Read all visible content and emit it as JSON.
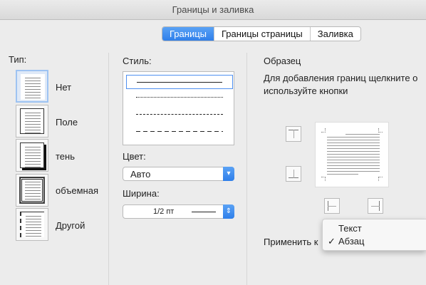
{
  "window": {
    "title": "Границы и заливка"
  },
  "tabs": [
    "Границы",
    "Границы страницы",
    "Заливка"
  ],
  "type_section": {
    "label": "Тип:",
    "options": [
      {
        "label": "Нет",
        "selected": true,
        "icon": "no-border-icon"
      },
      {
        "label": "Поле",
        "selected": false,
        "icon": "box-border-icon"
      },
      {
        "label": "тень",
        "selected": false,
        "icon": "shadow-border-icon"
      },
      {
        "label": "объемная",
        "selected": false,
        "icon": "3d-border-icon"
      },
      {
        "label": "Другой",
        "selected": false,
        "icon": "custom-border-icon"
      }
    ]
  },
  "style_section": {
    "label": "Стиль:",
    "styles": [
      "solid",
      "dotted",
      "dashed",
      "long-dashed"
    ],
    "selected_style": "solid",
    "color_label": "Цвет:",
    "color_value": "Авто",
    "width_label": "Ширина:",
    "width_value": "1/2 пт"
  },
  "preview_section": {
    "label": "Образец",
    "hint": "Для добавления границ щелкните о используйте кнопки",
    "apply_label": "Применить к"
  },
  "apply_menu": {
    "items": [
      "Текст",
      "Абзац"
    ],
    "checked": "Абзац"
  },
  "colors": {
    "accent": "#2f7fea",
    "selection": "#dfe9f7"
  }
}
